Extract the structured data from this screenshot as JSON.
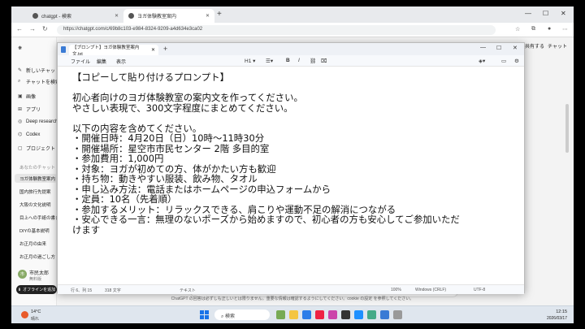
{
  "browser": {
    "tabs": [
      {
        "label": "chatgpt - 検索"
      },
      {
        "label": "ヨガ体験教室案内"
      }
    ],
    "url": "https://chatgpt.com/c/69b8c103-e984-8324-9209-a4d634e3ca02"
  },
  "chatgpt": {
    "sidebar": {
      "items": [
        {
          "label": "新しいチャット"
        },
        {
          "label": "チャットを検索"
        },
        {
          "label": "画像"
        },
        {
          "label": "アプリ"
        },
        {
          "label": "Deep research"
        },
        {
          "label": "Codex"
        },
        {
          "label": "プロジェクト"
        }
      ],
      "section_label": "あなたのチャット",
      "history": [
        "ヨガ体験教室案内",
        "国内旅行先提案",
        "大阪の文化説明",
        "目上への手紙の書き方",
        "DIYの基本説明",
        "お正月の由来",
        "お正月の過ごし方"
      ],
      "user_name": "市民太郎",
      "user_plan": "無料版",
      "offline_button": "オフラインを追加"
    },
    "share_label": "共有する",
    "chat_label": "チャット",
    "disclaimer": "ChatGPT の回答は必ずしも正しいとは限りません。重要な情報は確認するようにしてください。cookie の設定 を参照してください。"
  },
  "notepad": {
    "tab_title": "【プロンプト】ヨガ体験教室案内文.txt",
    "menu": [
      "ファイル",
      "編集",
      "表示"
    ],
    "heading_level": "H1",
    "lines": [
      "【コピーして貼り付けるプロンプト】",
      "",
      "初心者向けのヨガ体験教室の案内文を作ってください。",
      "やさしい表現で、300文字程度にまとめてください。",
      "",
      "以下の内容を含めてください。",
      "・開催日時：4月20日（日）10時～11時30分",
      "・開催場所：星空市市民センター 2階 多目的室",
      "・参加費用：1,000円",
      "・対象：ヨガが初めての方、体がかたい方も歓迎",
      "・持ち物：動きやすい服装、飲み物、タオル",
      "・申し込み方法：電話またはホームページの申込フォームから",
      "・定員：10名（先着順）",
      "・参加するメリット：リラックスできる、肩こりや運動不足の解消につながる",
      "・安心できる一言：無理のないポーズから始めますので、初心者の方も安心してご参加いただ",
      "けます"
    ],
    "status": {
      "position": "行 6、列 15",
      "chars": "318 文字",
      "format": "テキスト",
      "zoom": "100%",
      "line_ending": "Windows (CRLF)",
      "encoding": "UTF-8"
    }
  },
  "taskbar": {
    "weather_temp": "14°C",
    "weather_cond": "晴れ",
    "search_label": "検索",
    "time": "12:15",
    "date": "2026/03/17"
  }
}
